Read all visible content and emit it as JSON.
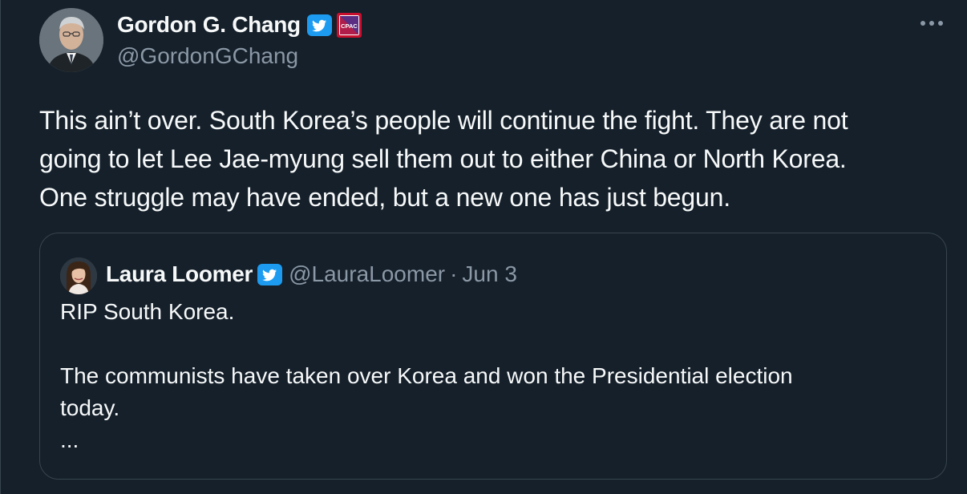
{
  "author": {
    "display_name": "Gordon G. Chang",
    "handle": "@GordonGChang",
    "verified_icon": "twitter-verified-badge-icon",
    "affiliate_badge_icon": "cpac-affiliate-badge-icon",
    "affiliate_badge_text": "CPAC"
  },
  "tweet": {
    "text": "This ain’t over. South Korea’s people will continue the fight. They are not\ngoing to let Lee Jae-myung sell them out to either China or North Korea.\nOne struggle may have ended, but a new one has just begun."
  },
  "more_menu": {
    "icon": "more-horizontal-icon"
  },
  "quoted_tweet": {
    "display_name": "Laura Loomer",
    "handle": "@LauraLoomer",
    "separator": "·",
    "date": "Jun 3",
    "verified_icon": "twitter-verified-badge-icon",
    "text": "RIP South Korea.\n\nThe communists have taken over Korea and won the Presidential election\ntoday.\n..."
  },
  "colors": {
    "background": "#15202b",
    "border": "#38444d",
    "primary_text": "#f7f9f9",
    "secondary_text": "#8b98a5",
    "verified_blue": "#1d9bf0"
  }
}
